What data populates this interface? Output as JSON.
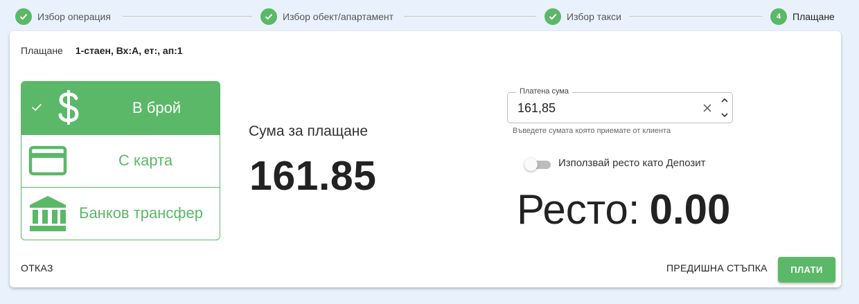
{
  "stepper": {
    "steps": [
      {
        "label": "Избор операция",
        "state": "done"
      },
      {
        "label": "Избор обект/апартамент",
        "state": "done"
      },
      {
        "label": "Избор такси",
        "state": "done"
      },
      {
        "label": "Плащане",
        "state": "active",
        "number": "4"
      }
    ]
  },
  "header": {
    "label": "Плащане",
    "value": "1-стаен, Вх:А, ет:, ап:1"
  },
  "methods": [
    {
      "label": "В брой",
      "icon": "dollar-icon",
      "selected": true
    },
    {
      "label": "С карта",
      "icon": "credit-card-icon",
      "selected": false
    },
    {
      "label": "Банков трансфер",
      "icon": "bank-icon",
      "selected": false
    }
  ],
  "amount": {
    "title": "Сума за плащане",
    "value": "161.85"
  },
  "paid": {
    "legend": "Платена сума",
    "value": "161,85",
    "hint": "Въведете сумата която приемате от клиента"
  },
  "deposit_toggle": {
    "label": "Използвай ресто като Депозит",
    "on": false
  },
  "change": {
    "label": "Ресто:",
    "value": "0.00"
  },
  "footer": {
    "cancel": "ОТКАЗ",
    "previous": "ПРЕДИШНА СТЪПКА",
    "pay": "ПЛАТИ"
  },
  "colors": {
    "accent": "#5bb868",
    "background": "#e9f2fc"
  }
}
